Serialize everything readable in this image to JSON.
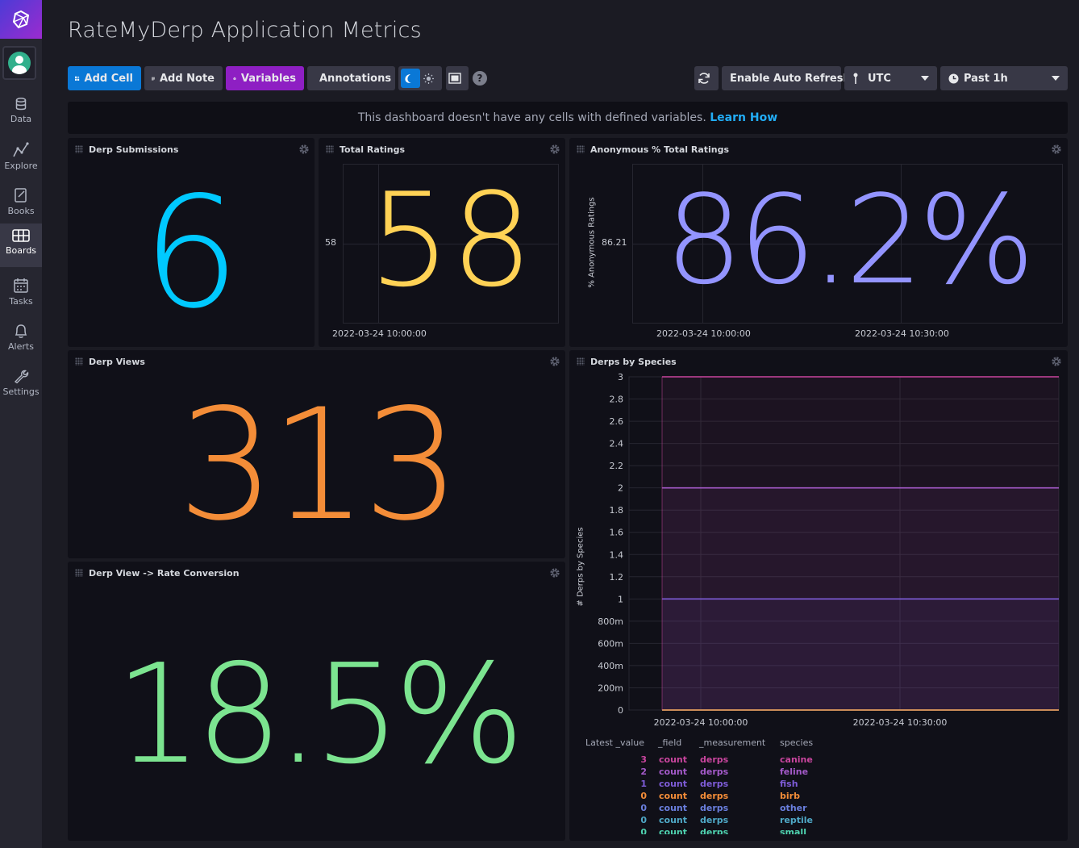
{
  "nav": {
    "items": [
      {
        "label": "Data",
        "icon": "database-icon"
      },
      {
        "label": "Explore",
        "icon": "explore-icon"
      },
      {
        "label": "Books",
        "icon": "notebook-icon"
      },
      {
        "label": "Boards",
        "icon": "dashboard-icon",
        "active": true
      },
      {
        "label": "Tasks",
        "icon": "calendar-icon"
      },
      {
        "label": "Alerts",
        "icon": "bell-icon"
      },
      {
        "label": "Settings",
        "icon": "wrench-icon"
      }
    ]
  },
  "page": {
    "title": "RateMyDerp Application Metrics"
  },
  "toolbar": {
    "add_cell": "Add Cell",
    "add_note": "Add Note",
    "variables": "Variables",
    "annotations": "Annotations",
    "auto_refresh": "Enable Auto Refresh",
    "timezone": "UTC",
    "time_range": "Past 1h"
  },
  "banner": {
    "text": "This dashboard doesn't have any cells with defined variables.",
    "link": "Learn How"
  },
  "cells": {
    "derp_submissions": {
      "title": "Derp Submissions",
      "value": "6",
      "color": "#00c9ff"
    },
    "total_ratings": {
      "title": "Total Ratings",
      "value": "58",
      "color": "#ffd255",
      "ytick": "58",
      "xtick": "2022-03-24 10:00:00"
    },
    "anon_pct": {
      "title": "Anonymous % Total Ratings",
      "value": "86.2%",
      "color": "#9394ff",
      "ytick": "86.21",
      "ylabel": "% Anonymous Ratings",
      "xticks": [
        "2022-03-24 10:00:00",
        "2022-03-24 10:30:00"
      ]
    },
    "derp_views": {
      "title": "Derp Views",
      "value": "313",
      "color": "#f48d38"
    },
    "conversion": {
      "title": "Derp View -> Rate Conversion",
      "value": "18.5%",
      "color": "#7ce490"
    },
    "species": {
      "title": "Derps by Species",
      "ylabel": "# Derps by Species"
    }
  },
  "chart_data": {
    "type": "line",
    "ylabel": "# Derps by Species",
    "ylim": [
      0,
      3
    ],
    "yticks": [
      "0",
      "200m",
      "400m",
      "600m",
      "800m",
      "1",
      "1.2",
      "1.4",
      "1.6",
      "1.8",
      "2",
      "2.2",
      "2.4",
      "2.6",
      "2.8",
      "3"
    ],
    "xticks": [
      "2022-03-24 10:00:00",
      "2022-03-24 10:30:00"
    ],
    "series": [
      {
        "name": "canine",
        "value": 3,
        "color": "#c9459e"
      },
      {
        "name": "feline",
        "value": 2,
        "color": "#a45ac9"
      },
      {
        "name": "fish",
        "value": 1,
        "color": "#7e5cd8"
      },
      {
        "name": "birb",
        "value": 0,
        "color": "#f48d38"
      },
      {
        "name": "other",
        "value": 0,
        "color": "#6a7fde"
      },
      {
        "name": "reptile",
        "value": 0,
        "color": "#4fa9c7"
      },
      {
        "name": "small",
        "value": 0,
        "color": "#4fd3b0"
      }
    ]
  },
  "legend": {
    "headers": [
      "Latest _value",
      "_field",
      "_measurement",
      "species"
    ],
    "rows": [
      {
        "value": "3",
        "field": "count",
        "measurement": "derps",
        "species": "canine",
        "color": "#c9459e"
      },
      {
        "value": "2",
        "field": "count",
        "measurement": "derps",
        "species": "feline",
        "color": "#a45ac9"
      },
      {
        "value": "1",
        "field": "count",
        "measurement": "derps",
        "species": "fish",
        "color": "#7e5cd8"
      },
      {
        "value": "0",
        "field": "count",
        "measurement": "derps",
        "species": "birb",
        "color": "#f48d38"
      },
      {
        "value": "0",
        "field": "count",
        "measurement": "derps",
        "species": "other",
        "color": "#6a7fde"
      },
      {
        "value": "0",
        "field": "count",
        "measurement": "derps",
        "species": "reptile",
        "color": "#4fa9c7"
      },
      {
        "value": "0",
        "field": "count",
        "measurement": "derps",
        "species": "small",
        "color": "#4fd3b0"
      }
    ]
  }
}
